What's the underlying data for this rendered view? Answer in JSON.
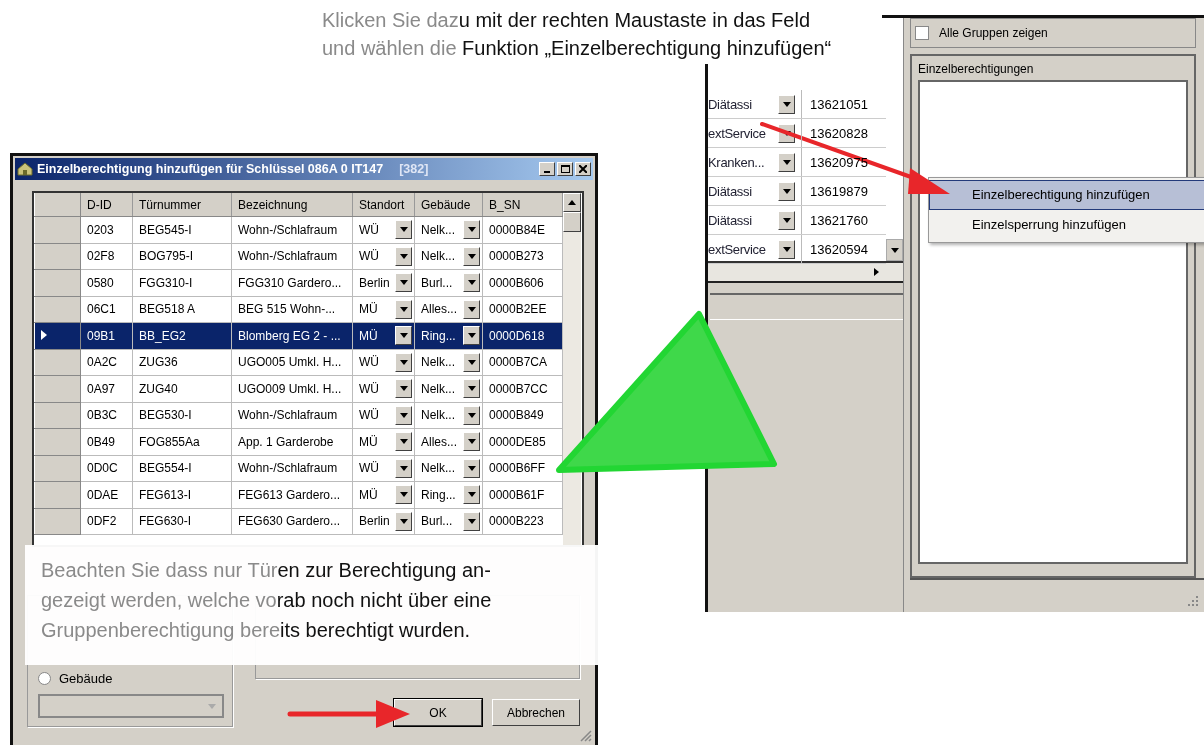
{
  "caption": {
    "lines": [
      {
        "faded": "Klicken Sie daz",
        "text": "u mit der rechten Maustaste in das Feld"
      },
      {
        "faded": "und wählen die ",
        "text": "Funktion „Einzelberechtigung hinzufügen“"
      }
    ]
  },
  "main_window": {
    "show_all": {
      "label": "Alle Gruppen zeigen",
      "checked": false
    },
    "group_title": "Einzelberechtigungen",
    "grid_rows": [
      {
        "name": "Diätassi",
        "number": "13621051"
      },
      {
        "name": "extService",
        "number": "13620828"
      },
      {
        "name": "Kranken...",
        "number": "13620975"
      },
      {
        "name": "Diätassi",
        "number": "13619879"
      },
      {
        "name": "Diätassi",
        "number": "13621760"
      },
      {
        "name": "extService",
        "number": "13620594"
      }
    ]
  },
  "context_menu": [
    {
      "label": "Einzelberechtigung hinzufügen",
      "selected": true
    },
    {
      "label": "Einzelsperrung hinzufügen",
      "selected": false
    }
  ],
  "dialog": {
    "title": "Einzelberechtigung hinzufügen für Schlüssel 086A 0 IT147",
    "count": "[382]",
    "columns": [
      {
        "label": "D-ID",
        "kind": "text"
      },
      {
        "label": "Türnummer",
        "kind": "text"
      },
      {
        "label": "Bezeichnung",
        "kind": "text"
      },
      {
        "label": "Standort",
        "kind": "combo"
      },
      {
        "label": "Gebäude",
        "kind": "combo"
      },
      {
        "label": "B_SN",
        "kind": "text"
      }
    ],
    "rows": [
      {
        "cells": [
          "0203",
          "BEG545-I",
          "Wohn-/Schlafraum",
          "WÜ",
          "Nelk...",
          "0000B84E"
        ],
        "selected": false
      },
      {
        "cells": [
          "02F8",
          "BOG795-I",
          "Wohn-/Schlafraum",
          "WÜ",
          "Nelk...",
          "0000B273"
        ],
        "selected": false
      },
      {
        "cells": [
          "0580",
          "FGG310-I",
          "FGG310 Gardero...",
          "Berlin",
          "Burl...",
          "0000B606"
        ],
        "selected": false
      },
      {
        "cells": [
          "06C1",
          "BEG518 A",
          "BEG 515 Wohn-...",
          "MÜ",
          "Alles...",
          "0000B2EE"
        ],
        "selected": false
      },
      {
        "cells": [
          "09B1",
          "BB_EG2",
          "Blomberg EG 2 - ...",
          "MÜ",
          "Ring...",
          "0000D618"
        ],
        "selected": true
      },
      {
        "cells": [
          "0A2C",
          "ZUG36",
          "UGO005 Umkl. H...",
          "WÜ",
          "Nelk...",
          "0000B7CA"
        ],
        "selected": false
      },
      {
        "cells": [
          "0A97",
          "ZUG40",
          "UGO009 Umkl. H...",
          "WÜ",
          "Nelk...",
          "0000B7CC"
        ],
        "selected": false
      },
      {
        "cells": [
          "0B3C",
          "BEG530-I",
          "Wohn-/Schlafraum",
          "WÜ",
          "Nelk...",
          "0000B849"
        ],
        "selected": false
      },
      {
        "cells": [
          "0B49",
          "FOG855Aa",
          "App. 1 Garderobe",
          "MÜ",
          "Alles...",
          "0000DE85"
        ],
        "selected": false
      },
      {
        "cells": [
          "0D0C",
          "BEG554-I",
          "Wohn-/Schlafraum",
          "WÜ",
          "Nelk...",
          "0000B6FF"
        ],
        "selected": false
      },
      {
        "cells": [
          "0DAE",
          "FEG613-I",
          "FEG613 Gardero...",
          "MÜ",
          "Ring...",
          "0000B61F"
        ],
        "selected": false
      },
      {
        "cells": [
          "0DF2",
          "FEG630-I",
          "FEG630 Gardero...",
          "Berlin",
          "Burl...",
          "0000B223"
        ],
        "selected": false
      }
    ],
    "radio": {
      "label": "Gebäude",
      "selected": false
    },
    "buttons": [
      {
        "label": "OK",
        "default": true
      },
      {
        "label": "Abbrechen",
        "default": false
      }
    ]
  },
  "note": {
    "lines": [
      {
        "faded": "Beachten Sie dass nur Tür",
        "text": "en zur Berechtigung an-"
      },
      {
        "faded": "gezeigt werden, welche vo",
        "text": "rab noch nicht über eine"
      },
      {
        "faded": "Gruppenberechtigung bere",
        "text": "its berechtigt wurden."
      }
    ]
  }
}
